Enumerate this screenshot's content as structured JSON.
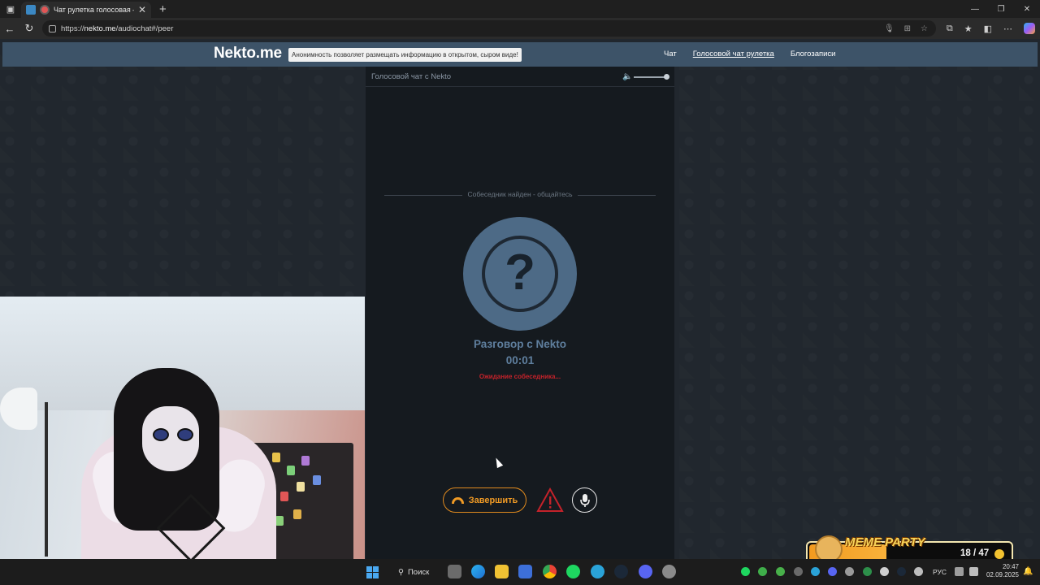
{
  "browser": {
    "tabs": [
      {
        "title": "Чат рулетка голосовая — N",
        "close": "✕"
      }
    ],
    "new_tab": "+",
    "url_prefix": "https://",
    "url_host": "nekto.me",
    "url_path": "/audiochat#/peer"
  },
  "site": {
    "logo": "Nekto.me",
    "slogan": "Анонимность позволяет размещать информацию в открытом, сыром виде!",
    "menu": [
      {
        "label": "Чат",
        "active": false
      },
      {
        "label": "Голосовой чат рулетка",
        "active": true
      },
      {
        "label": "Блогозаписи",
        "active": false
      }
    ]
  },
  "chat": {
    "header_title": "Голосовой чат с Nekto",
    "volume_level": 1.0,
    "status_line": "Собеседник найден - общайтесь",
    "avatar_symbol": "?",
    "conversation_title": "Разговор с Nekto",
    "timer": "00:01",
    "waiting_text": "Ожидание собеседника...",
    "end_button": "Завершить",
    "colors": {
      "accent": "#ef9a25",
      "avatar": "#4d6a86",
      "warning": "#c4222a",
      "header": "#3d5368"
    }
  },
  "meme_party": {
    "title": "MEME PARTY",
    "count": "18 / 47"
  },
  "taskbar": {
    "search_label": "Поиск",
    "language": "РУС",
    "time": "20:47",
    "date": "02.09.2025"
  }
}
